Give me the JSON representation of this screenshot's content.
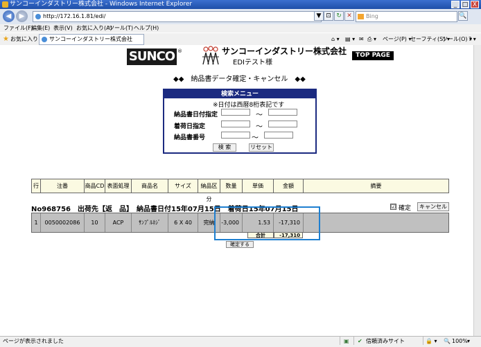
{
  "window": {
    "title": "サンコーインダストリー株式会社 - Windows Internet Explorer",
    "min": "_",
    "max": "□",
    "close": "X"
  },
  "address": {
    "back": "◀",
    "forward": "▶",
    "url": "http://172.16.1.81/edi/",
    "dropdown": "▼",
    "compat": "⊡",
    "refresh": "↻",
    "stop": "✕",
    "search_placeholder": "Bing",
    "search_btn": "🔍"
  },
  "menubar": [
    "ファイル(F)",
    "編集(E)",
    "表示(V)",
    "お気に入り(A)",
    "ツール(T)",
    "ヘルプ(H)"
  ],
  "favbar": {
    "favorites": "お気に入り",
    "tab": "サンコーインダストリー株式会社",
    "commands": [
      "ページ(P) ▾",
      "セーフティ(S) ▾",
      "ツール(O) ▾",
      "? ▾"
    ]
  },
  "header": {
    "logo": "SUNCO",
    "registered": "®",
    "company": "サンコーインダストリー株式会社",
    "user": "EDIテスト様",
    "top_page": "TOP PAGE"
  },
  "page_heading": "◆◆　納品書データ確定・キャンセル　◆◆",
  "search_menu": {
    "title": "検索メニュー",
    "note": "※日付は西暦8桁表記です",
    "fields": [
      {
        "label": "納品書日付指定",
        "from": "",
        "to": ""
      },
      {
        "label": "着荷日指定",
        "from": "",
        "to": ""
      },
      {
        "label": "納品書番号",
        "from": "",
        "to": ""
      }
    ],
    "tilde": "～",
    "search_button": "検 索",
    "reset_button": "リセット"
  },
  "table": {
    "headers": [
      "行",
      "注番",
      "商品CD",
      "表面処理",
      "商品名",
      "サイズ",
      "納品区分",
      "数量",
      "単価",
      "金額",
      "摘要"
    ],
    "group_header": "No968756　出荷先【返　品】　納品書日付15年07月15日　着荷日15年07月15日",
    "confirm_checkbox": "☑",
    "confirm_label": "確定",
    "cancel_button": "キャンセル",
    "rows": [
      {
        "line": "1",
        "order_no": "0050002086",
        "product_cd": "10",
        "surface": "ACP",
        "product": "ｻﾝﾌﾟﾙﾈｼﾞ",
        "size": "6 X 40",
        "delivery": "完納",
        "qty": "-3,000",
        "unit_price": "1.53",
        "amount": "-17,310",
        "note": ""
      }
    ],
    "total_label": "合計",
    "total_value": "-17,310",
    "confirm_button": "確定する"
  },
  "statusbar": {
    "text": "ページが表示されました",
    "zone": "信頼済みサイト",
    "zoom": "100%"
  }
}
